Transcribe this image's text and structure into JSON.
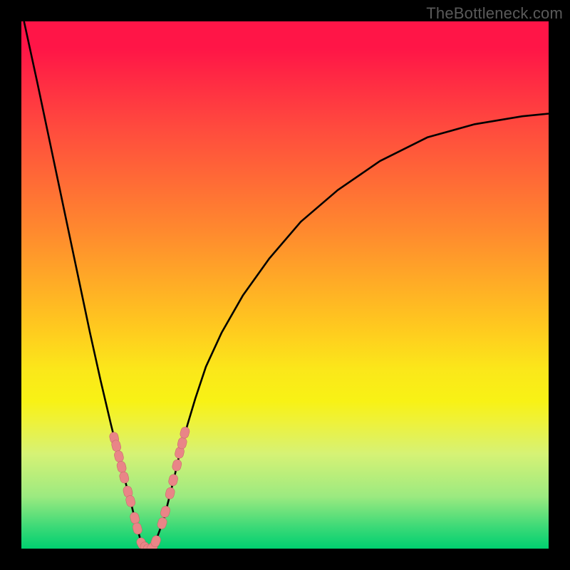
{
  "watermark": "TheBottleneck.com",
  "colors": {
    "frame": "#000000",
    "curve": "#000000",
    "marker_fill": "#e98587",
    "marker_stroke": "#c96b6d"
  },
  "chart_data": {
    "type": "line",
    "title": "",
    "xlabel": "",
    "ylabel": "",
    "xlim": [
      -1,
      9
    ],
    "ylim": [
      0,
      10
    ],
    "grid": false,
    "legend": false,
    "series": [
      {
        "name": "curve",
        "x": [
          -0.95,
          -0.7,
          -0.5,
          -0.3,
          -0.1,
          0.1,
          0.3,
          0.5,
          0.7,
          0.9,
          1.1,
          1.18,
          1.3,
          1.4,
          1.5,
          1.55,
          1.7,
          1.8,
          1.9,
          2.0,
          2.15,
          2.3,
          2.5,
          2.8,
          3.2,
          3.7,
          4.3,
          5.0,
          5.8,
          6.7,
          7.6,
          8.5,
          9.0
        ],
        "y": [
          10.0,
          8.85,
          7.9,
          6.95,
          6.0,
          5.05,
          4.1,
          3.2,
          2.35,
          1.55,
          0.78,
          0.45,
          0.02,
          0.0,
          0.02,
          0.15,
          0.55,
          0.95,
          1.35,
          1.8,
          2.35,
          2.85,
          3.45,
          4.1,
          4.8,
          5.5,
          6.2,
          6.8,
          7.35,
          7.8,
          8.05,
          8.2,
          8.25
        ]
      }
    ],
    "markers": [
      {
        "x": 0.76,
        "y": 2.1
      },
      {
        "x": 0.8,
        "y": 1.95
      },
      {
        "x": 0.85,
        "y": 1.75
      },
      {
        "x": 0.9,
        "y": 1.55
      },
      {
        "x": 0.95,
        "y": 1.35
      },
      {
        "x": 1.02,
        "y": 1.08
      },
      {
        "x": 1.07,
        "y": 0.9
      },
      {
        "x": 1.15,
        "y": 0.58
      },
      {
        "x": 1.2,
        "y": 0.38
      },
      {
        "x": 1.28,
        "y": 0.1
      },
      {
        "x": 1.35,
        "y": 0.02
      },
      {
        "x": 1.42,
        "y": 0.0
      },
      {
        "x": 1.48,
        "y": 0.02
      },
      {
        "x": 1.55,
        "y": 0.14
      },
      {
        "x": 1.67,
        "y": 0.48
      },
      {
        "x": 1.73,
        "y": 0.7
      },
      {
        "x": 1.82,
        "y": 1.05
      },
      {
        "x": 1.88,
        "y": 1.3
      },
      {
        "x": 1.95,
        "y": 1.58
      },
      {
        "x": 2.0,
        "y": 1.82
      },
      {
        "x": 2.05,
        "y": 2.0
      },
      {
        "x": 2.1,
        "y": 2.2
      }
    ]
  }
}
